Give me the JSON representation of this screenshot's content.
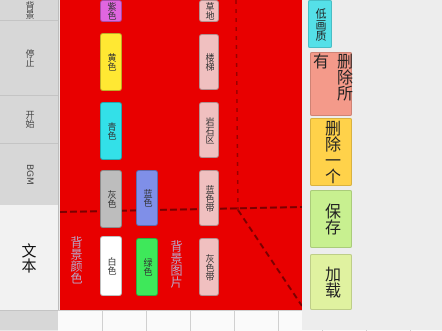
{
  "sidebar": {
    "tabs": [
      {
        "label": "背景"
      },
      {
        "label": "停止"
      },
      {
        "label": "开始"
      },
      {
        "label": "BGM"
      },
      {
        "label": "文本"
      }
    ]
  },
  "canvas": {
    "background_color": "#e80000",
    "sections": [
      {
        "label": "背景颜色"
      },
      {
        "label": "背景图片"
      }
    ],
    "color_chips": [
      {
        "label": "白色",
        "color": "#ffffff"
      },
      {
        "label": "灰色",
        "color": "#bdbdbd"
      },
      {
        "label": "青色",
        "color": "#33e0e8"
      },
      {
        "label": "黄色",
        "color": "#ffe833"
      },
      {
        "label": "紫色",
        "color": "#e066e0"
      },
      {
        "label": "绿色",
        "color": "#3ee85a"
      },
      {
        "label": "蓝色",
        "color": "#7f8fe8"
      }
    ],
    "image_chips": [
      {
        "label": "灰色带",
        "color": "#f0c0c0"
      },
      {
        "label": "蓝色带",
        "color": "#f0c0c0"
      },
      {
        "label": "岩石区",
        "color": "#f0c0c0"
      },
      {
        "label": "楼梯",
        "color": "#f0c0c0"
      },
      {
        "label": "草地",
        "color": "#f0c0c0"
      }
    ]
  },
  "actions": {
    "load": {
      "label": "加载",
      "color": "#e0f2a0"
    },
    "save": {
      "label": "保存",
      "color": "#c8f090"
    },
    "delete_one": {
      "label": "删除一个",
      "color": "#ffd24a"
    },
    "delete_all": {
      "label": "删除所有",
      "color": "#f49a8a"
    },
    "low_quality": {
      "label": "低画质",
      "color": "#55e0e8"
    }
  }
}
